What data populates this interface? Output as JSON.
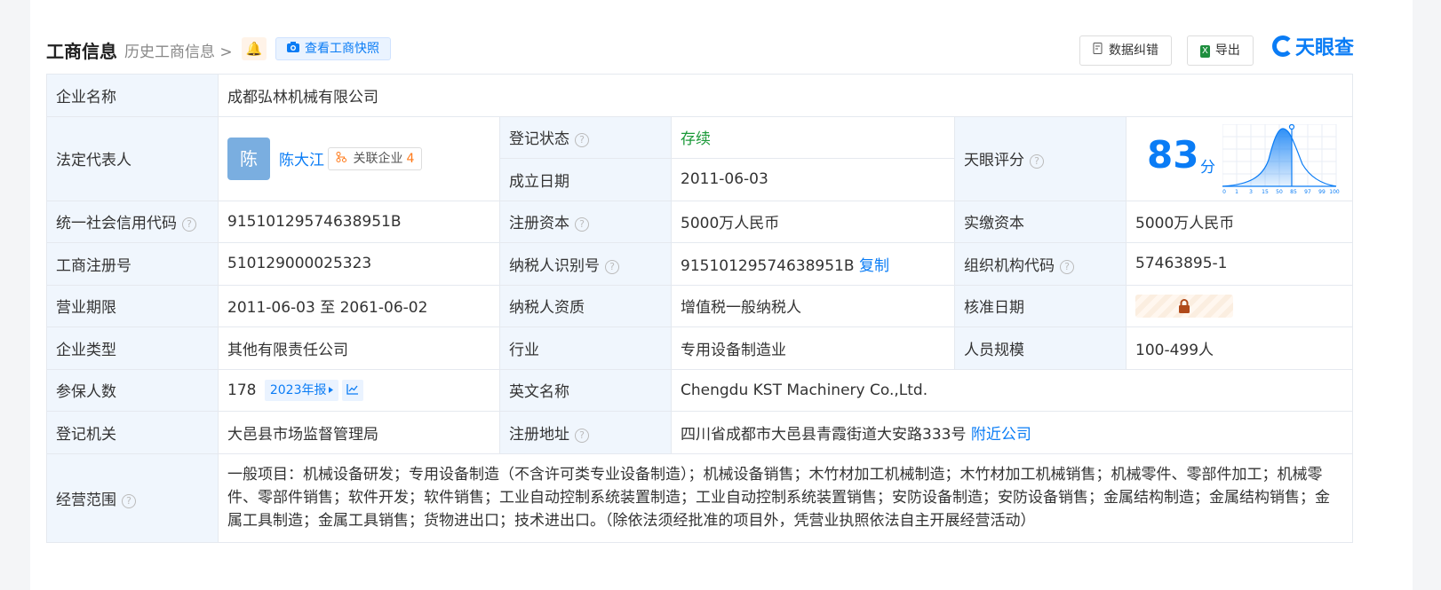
{
  "header": {
    "title": "工商信息",
    "history_label": "历史工商信息",
    "history_arrow": ">",
    "bell_glyph": "🔔",
    "snapshot_label": "查看工商快照",
    "correction_label": "数据纠错",
    "export_label": "导出",
    "export_icon_text": "X",
    "logo_text": "天眼查"
  },
  "colors": {
    "accent": "#0a7cf5",
    "label_bg": "#f0f6fd",
    "status_green": "#1c9a3a",
    "orange": "#ff7a1a"
  },
  "table": {
    "company_name_label": "企业名称",
    "company_name": "成都弘林机械有限公司",
    "legal_rep_label": "法定代表人",
    "legal_rep_avatar": "陈",
    "legal_rep_name": "陈大江",
    "related_label": "关联企业",
    "related_count": "4",
    "reg_status_label": "登记状态",
    "reg_status": "存续",
    "founded_label": "成立日期",
    "founded": "2011-06-03",
    "score_label": "天眼评分",
    "score": "83",
    "score_unit": "分",
    "score_axis": [
      "0",
      "1",
      "3",
      "15",
      "50",
      "85",
      "97",
      "99",
      "100"
    ],
    "credit_code_label": "统一社会信用代码",
    "credit_code": "91510129574638951B",
    "reg_capital_label": "注册资本",
    "reg_capital": "5000万人民币",
    "paid_capital_label": "实缴资本",
    "paid_capital": "5000万人民币",
    "biz_reg_no_label": "工商注册号",
    "biz_reg_no": "510129000025323",
    "taxpayer_id_label": "纳税人识别号",
    "taxpayer_id": "91510129574638951B",
    "copy_label": "复制",
    "org_code_label": "组织机构代码",
    "org_code": "57463895-1",
    "term_label": "营业期限",
    "term": "2011-06-03 至 2061-06-02",
    "taxpayer_qual_label": "纳税人资质",
    "taxpayer_qual": "增值税一般纳税人",
    "approve_date_label": "核准日期",
    "company_type_label": "企业类型",
    "company_type": "其他有限责任公司",
    "industry_label": "行业",
    "industry": "专用设备制造业",
    "staff_size_label": "人员规模",
    "staff_size": "100-499人",
    "insured_label": "参保人数",
    "insured": "178",
    "report_label": "2023年报",
    "english_name_label": "英文名称",
    "english_name": "Chengdu KST Machinery Co.,Ltd.",
    "authority_label": "登记机关",
    "authority": "大邑县市场监督管理局",
    "address_label": "注册地址",
    "address": "四川省成都市大邑县青霞街道大安路333号",
    "nearby_label": "附近公司",
    "scope_label": "经营范围",
    "scope": "一般项目：机械设备研发；专用设备制造（不含许可类专业设备制造）；机械设备销售；木竹材加工机械制造；木竹材加工机械销售；机械零件、零部件加工；机械零件、零部件销售；软件开发；软件销售；工业自动控制系统装置制造；工业自动控制系统装置销售；安防设备制造；安防设备销售；金属结构制造；金属结构销售；金属工具制造；金属工具销售；货物进出口；技术进出口。（除依法须经批准的项目外，凭营业执照依法自主开展经营活动）"
  }
}
